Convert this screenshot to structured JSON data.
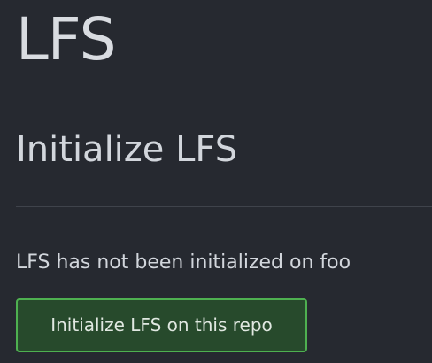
{
  "header": {
    "title": "LFS"
  },
  "section": {
    "title": "Initialize LFS",
    "status_message": "LFS has not been initialized on foo",
    "init_button_label": "Initialize LFS on this repo"
  },
  "colors": {
    "background": "#262930",
    "text": "#d6d9de",
    "button_border": "#4eb050",
    "button_fill": "#274a2c",
    "divider": "#3f434b"
  }
}
